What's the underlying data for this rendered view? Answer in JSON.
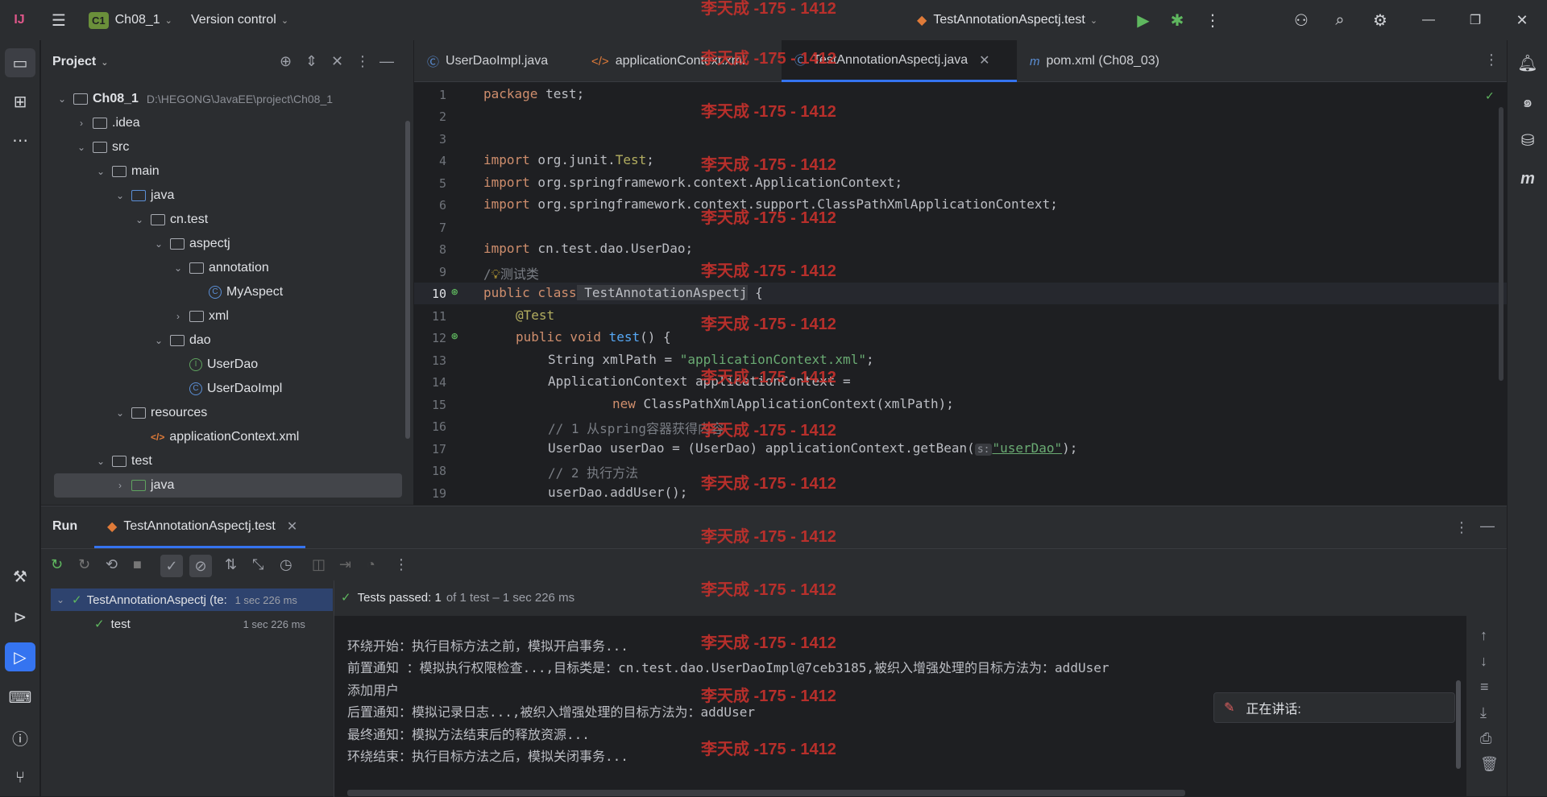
{
  "titlebar": {
    "project_badge": "C1",
    "project_name": "Ch08_1",
    "vcs_label": "Version control",
    "run_config": "TestAnnotationAspectj.test"
  },
  "project_panel": {
    "title": "Project",
    "tree": [
      {
        "label": "Ch08_1",
        "path": "D:\\HEGONG\\JavaEE\\project\\Ch08_1"
      },
      {
        "label": ".idea"
      },
      {
        "label": "src"
      },
      {
        "label": "main"
      },
      {
        "label": "java"
      },
      {
        "label": "cn.test"
      },
      {
        "label": "aspectj"
      },
      {
        "label": "annotation"
      },
      {
        "label": "MyAspect"
      },
      {
        "label": "xml"
      },
      {
        "label": "dao"
      },
      {
        "label": "UserDao"
      },
      {
        "label": "UserDaoImpl"
      },
      {
        "label": "resources"
      },
      {
        "label": "applicationContext.xml"
      },
      {
        "label": "test"
      },
      {
        "label": "java"
      }
    ]
  },
  "editor_tabs": [
    {
      "label": "UserDaoImpl.java"
    },
    {
      "label": "applicationContext.xml"
    },
    {
      "label": "TestAnnotationAspectj.java"
    },
    {
      "label": "pom.xml (Ch08_03)"
    }
  ],
  "code": {
    "line_numbers": [
      "1",
      "2",
      "3",
      "4",
      "5",
      "6",
      "7",
      "8",
      "9",
      "10",
      "11",
      "12",
      "13",
      "14",
      "15",
      "16",
      "17",
      "18",
      "19"
    ],
    "l1_kw": "package",
    "l1_rest": " test;",
    "l4_kw": "import",
    "l4_rest": " org.junit.",
    "l4_cls": "Test",
    "l4_end": ";",
    "l5_kw": "import",
    "l5_rest": " org.springframework.context.ApplicationContext;",
    "l6_kw": "import",
    "l6_rest": " org.springframework.context.support.ClassPathXmlApplicationContext;",
    "l8_kw": "import",
    "l8_rest": " cn.test.dao.UserDao;",
    "l9_comment": "测试类",
    "l10_kw": "public class",
    "l10_name": " TestAnnotationAspectj",
    "l10_end": " {",
    "l11_ann": "@Test",
    "l12_kw": "public void",
    "l12_fn": " test",
    "l12_end": "() {",
    "l13_a": "String xmlPath = ",
    "l13_str": "\"applicationContext.xml\"",
    "l13_end": ";",
    "l14": "ApplicationContext applicationContext =",
    "l15_kw": "new",
    "l15_rest": " ClassPathXmlApplicationContext(xmlPath);",
    "l16": "// 1 从spring容器获得内容",
    "l17_a": "UserDao userDao = (UserDao) applicationContext.getBean(",
    "l17_hint": "s:",
    "l17_str": "\"userDao\"",
    "l17_end": ");",
    "l18": "// 2 执行方法",
    "l19": "userDao.addUser();"
  },
  "run_panel": {
    "title": "Run",
    "tab": "TestAnnotationAspectj.test",
    "root_test": "TestAnnotationAspectj (te:",
    "root_time": "1 sec 226 ms",
    "child_test": "test",
    "child_time": "1 sec 226 ms",
    "status_main": "Tests passed: 1",
    "status_detail": "of 1 test – 1 sec 226 ms",
    "output": [
      "环绕开始：执行目标方法之前，模拟开启事务...",
      "前置通知 ：模拟执行权限检查...,目标类是：cn.test.dao.UserDaoImpl@7ceb3185,被织入增强处理的目标方法为：addUser",
      "添加用户",
      "后置通知：模拟记录日志...,被织入增强处理的目标方法为：addUser",
      "最终通知：模拟方法结束后的释放资源...",
      "环绕结束：执行目标方法之后，模拟关闭事务..."
    ],
    "speaking_label": "正在讲话:"
  },
  "watermark": "李天成 -175 - 1412"
}
